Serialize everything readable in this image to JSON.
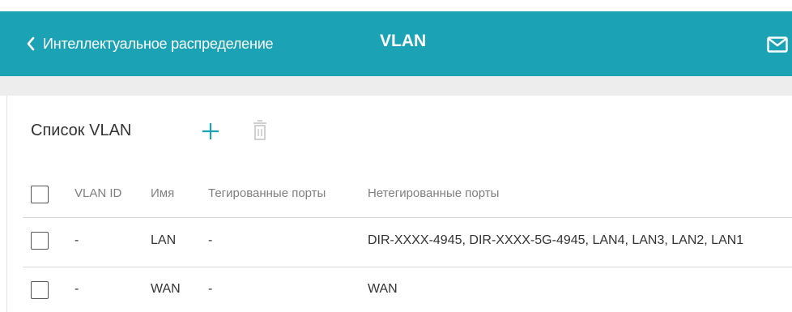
{
  "header": {
    "back_label": "Интеллектуальное распределение",
    "title": "VLAN",
    "background": "#1ba3b5",
    "back_icon": "chevron-left-icon",
    "mail_icon": "mail-icon"
  },
  "section": {
    "title": "Список VLAN",
    "add_icon": "plus-icon",
    "delete_icon": "trash-icon"
  },
  "table": {
    "columns": [
      "VLAN ID",
      "Имя",
      "Тегированные порты",
      "Нетегированные порты"
    ],
    "rows": [
      {
        "vlan_id": "-",
        "name": "LAN",
        "tagged": "-",
        "untagged": "DIR-XXXX-4945, DIR-XXXX-5G-4945, LAN4, LAN3, LAN2, LAN1",
        "checked": false
      },
      {
        "vlan_id": "-",
        "name": "WAN",
        "tagged": "-",
        "untagged": "WAN",
        "checked": false
      }
    ]
  }
}
